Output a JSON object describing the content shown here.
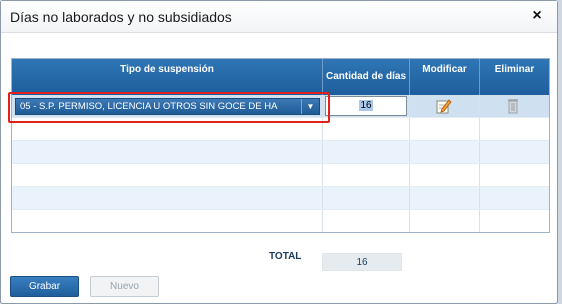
{
  "dialog": {
    "title": "Días no laborados y no subsidiados",
    "close_label": "×"
  },
  "grid": {
    "columns": [
      "Tipo de suspensión",
      "Cantidad de días",
      "Modificar",
      "Eliminar"
    ],
    "rows": [
      {
        "tipo": "05 - S.P. PERMISO, LICENCIA U OTROS SIN GOCE DE HA",
        "cantidad": "16"
      }
    ]
  },
  "total": {
    "label": "TOTAL",
    "value": "16"
  },
  "buttons": {
    "grabar": "Grabar",
    "nuevo": "Nuevo"
  },
  "colors": {
    "accent": "#2f75b4",
    "highlight": "#e0221a"
  }
}
